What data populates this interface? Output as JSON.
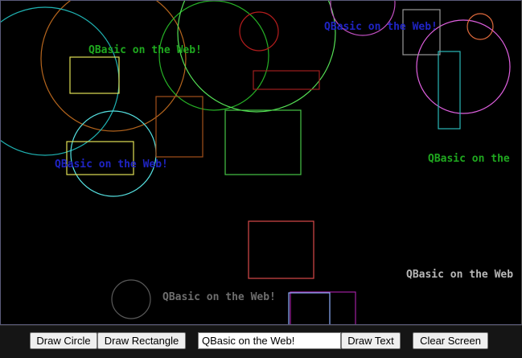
{
  "canvas": {
    "background": "#000000",
    "labels": [
      {
        "text": "QBasic on the Web!",
        "color": "#1fa81f"
      },
      {
        "text": "QBasic on the Web!",
        "color": "#1f24c4"
      },
      {
        "text": "QBasic on the Web!",
        "color": "#1f24c4"
      },
      {
        "text": "QBasic on the",
        "color": "#1fa81f"
      },
      {
        "text": "QBasic on the Web",
        "color": "#b8b8b8"
      },
      {
        "text": "QBasic on the Web!",
        "color": "#6e6e6e"
      }
    ]
  },
  "toolbar": {
    "draw_circle_label": "Draw Circle",
    "draw_rectangle_label": "Draw Rectangle",
    "text_input_value": "QBasic on the Web!",
    "draw_text_label": "Draw Text",
    "clear_screen_label": "Clear Screen"
  }
}
